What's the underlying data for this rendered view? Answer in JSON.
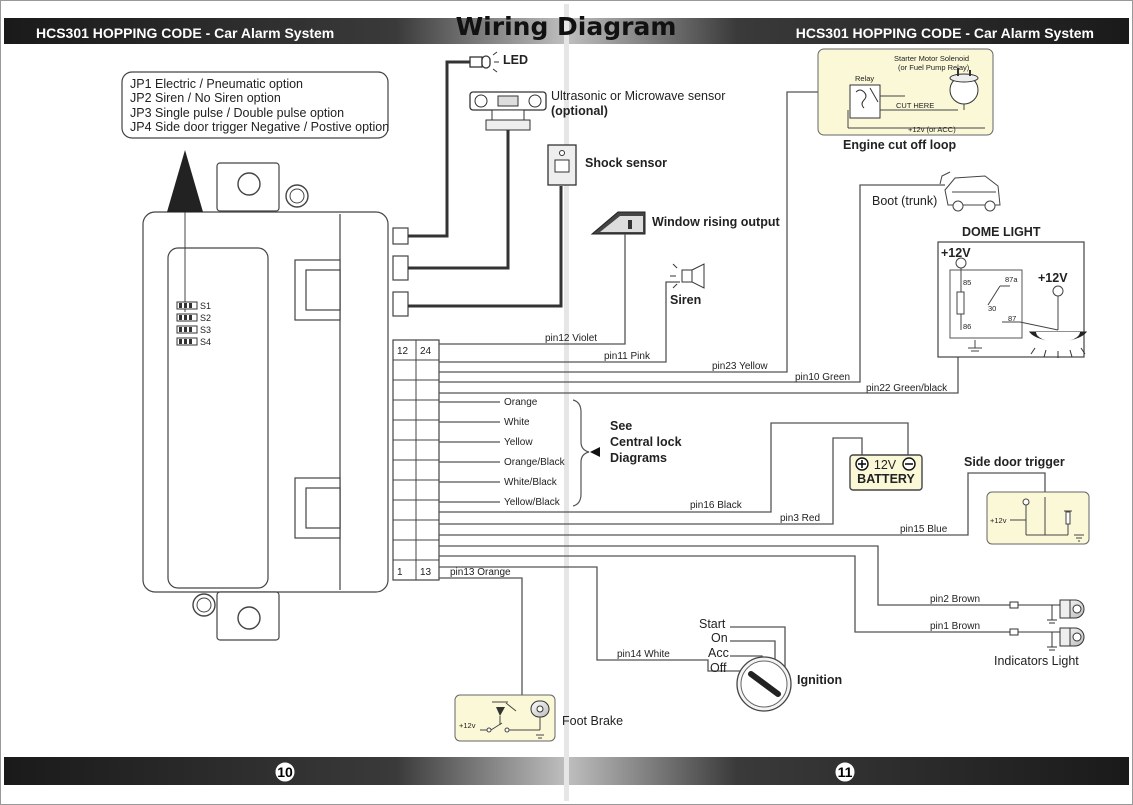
{
  "header": {
    "left": "HCS301 HOPPING CODE - Car Alarm System",
    "title": "Wiring Diagram",
    "right": "HCS301 HOPPING CODE - Car Alarm System"
  },
  "jumpers": [
    "JP1 Electric / Pneumatic option",
    "JP2 Siren / No Siren option",
    "JP3 Single pulse / Double pulse option",
    "JP4 Side door trigger Negative / Postive option"
  ],
  "switches": [
    "S1",
    "S2",
    "S3",
    "S4"
  ],
  "connector": {
    "top_left": "12",
    "top_right": "24",
    "bottom_left": "1",
    "bottom_right": "13"
  },
  "components": {
    "led": "LED",
    "sensor_line1": "Ultrasonic or Microwave sensor",
    "sensor_line2": "(optional)",
    "shock": "Shock sensor",
    "window": "Window rising output",
    "siren": "Siren",
    "boot": "Boot (trunk)",
    "dome": "DOME LIGHT",
    "engine": "Engine cut off loop",
    "starter_line1": "Starter Motor Solenoid",
    "starter_line2": "(or Fuel Pump Relay)",
    "relay": "Relay",
    "cut_here": "CUT HERE",
    "acc_note": "+12v (or ACC)",
    "battery_volt": "12V",
    "battery": "BATTERY",
    "side_door": "Side door trigger",
    "indicators": "Indicators Light",
    "ignition": "Ignition",
    "foot_brake": "Foot Brake",
    "plus12": "+12V",
    "plus12v": "+12v"
  },
  "ignition_positions": [
    "Start",
    "On",
    "Acc",
    "Off"
  ],
  "relay_pins": {
    "p85": "85",
    "p86": "86",
    "p87a": "87a",
    "p30": "30",
    "p87": "87"
  },
  "central_lock": {
    "wires": [
      "Orange",
      "White",
      "Yellow",
      "Orange/Black",
      "White/Black",
      "Yellow/Black"
    ],
    "see_line1": "See",
    "see_line2": "Central lock",
    "see_line3": "Diagrams"
  },
  "pins": {
    "pin12": "pin12  Violet",
    "pin11": "pin11  Pink",
    "pin23": "pin23  Yellow",
    "pin10": "pin10  Green",
    "pin22": "pin22  Green/black",
    "pin16": "pin16  Black",
    "pin3": "pin3  Red",
    "pin15": "pin15  Blue",
    "pin13": "pin13  Orange",
    "pin2": "pin2  Brown",
    "pin1": "pin1  Brown",
    "pin14": "pin14  White"
  },
  "footer": {
    "left_page": "10",
    "right_page": "11"
  }
}
